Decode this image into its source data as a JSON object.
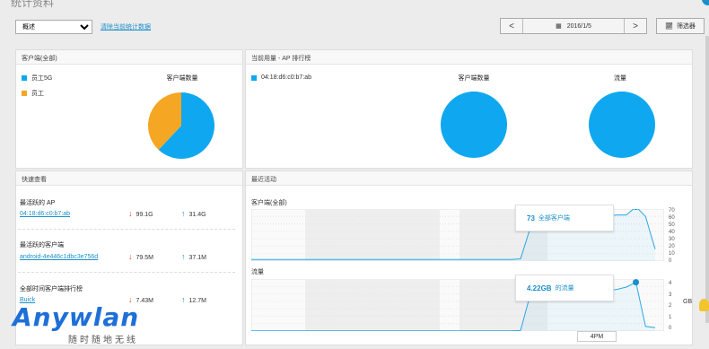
{
  "header": {
    "title": "统计资料",
    "view_select": "概述",
    "clear_link": "清除当前统计数据"
  },
  "datebar": {
    "prev": "<",
    "date": "2016/1/5",
    "next": ">",
    "filter": "筛选器"
  },
  "clients_panel": {
    "title": "客户端(全部)",
    "legend": [
      {
        "label": "员工5G",
        "color": "#0fa8f0"
      },
      {
        "label": "员工",
        "color": "#f5a623"
      }
    ],
    "chart_title": "客户端数量"
  },
  "usage_panel": {
    "title": "当前用量 - AP 排行榜",
    "legend": [
      {
        "label": "04:18:d6:c0:b7:ab",
        "color": "#0fa8f0"
      }
    ],
    "chart1_title": "客户端数量",
    "chart2_title": "流量"
  },
  "quickview": {
    "title": "快速查看",
    "items": [
      {
        "heading": "最活跃的 AP",
        "link": "04:18:d6:c0:b7:ab",
        "down": "99.1G",
        "up": "31.4G"
      },
      {
        "heading": "最活跃的客户端",
        "link": "android-4e446c1dbc3e756d",
        "down": "79.5M",
        "up": "37.1M"
      },
      {
        "heading": "全部时间客户端排行榜",
        "link": "Buick",
        "down": "7.43M",
        "up": "12.7M"
      }
    ]
  },
  "activity": {
    "title": "最近活动",
    "clients_label": "客户端(全部)",
    "traffic_label": "流量",
    "clients_tooltip": {
      "value": "73",
      "label": "全部客户端"
    },
    "traffic_tooltip": {
      "value": "4.22GB",
      "label": "的流量"
    },
    "clients_ticks": [
      "70",
      "60",
      "50",
      "40",
      "30",
      "20",
      "10",
      "0"
    ],
    "traffic_ticks": [
      "4",
      "3",
      "2",
      "1",
      "0"
    ],
    "traffic_unit": "GB",
    "time_label": "4PM"
  },
  "chart_data": [
    {
      "type": "pie",
      "title": "客户端数量",
      "labels": [
        "员工5G",
        "员工"
      ],
      "values": [
        62,
        38
      ],
      "colors": [
        "#0fa8f0",
        "#f5a623"
      ]
    },
    {
      "type": "pie",
      "title": "客户端数量",
      "labels": [
        "04:18:d6:c0:b7:ab"
      ],
      "values": [
        100
      ],
      "colors": [
        "#0fa8f0"
      ]
    },
    {
      "type": "pie",
      "title": "流量",
      "labels": [
        "04:18:d6:c0:b7:ab"
      ],
      "values": [
        100
      ],
      "colors": [
        "#0fa8f0"
      ]
    },
    {
      "type": "area",
      "title": "客户端(全部)",
      "ylim": [
        0,
        70
      ],
      "values": [
        2,
        2,
        2,
        2,
        2,
        2,
        2,
        2,
        2,
        2,
        2,
        2,
        2,
        2,
        2,
        2,
        2,
        2,
        2,
        2,
        2,
        2,
        2,
        2,
        2,
        2,
        2,
        2,
        3,
        44,
        57,
        57,
        60,
        60,
        60,
        60,
        61,
        61,
        62,
        62,
        73,
        60,
        16
      ]
    },
    {
      "type": "area",
      "title": "流量",
      "ylim": [
        0,
        4.5
      ],
      "values": [
        0.02,
        0.02,
        0.02,
        0.02,
        0.02,
        0.02,
        0.02,
        0.02,
        0.02,
        0.02,
        0.02,
        0.02,
        0.02,
        0.02,
        0.02,
        0.02,
        0.02,
        0.02,
        0.02,
        0.02,
        0.02,
        0.02,
        0.02,
        0.02,
        0.02,
        0.02,
        0.02,
        0.02,
        0.05,
        3.1,
        3.1,
        3.2,
        3.3,
        3.2,
        3.2,
        3.3,
        3.4,
        3.5,
        3.6,
        3.8,
        4.22,
        0.4,
        0.3
      ]
    }
  ],
  "watermark": {
    "brand": "Anywlan",
    "slogan": "随时随地无线"
  }
}
